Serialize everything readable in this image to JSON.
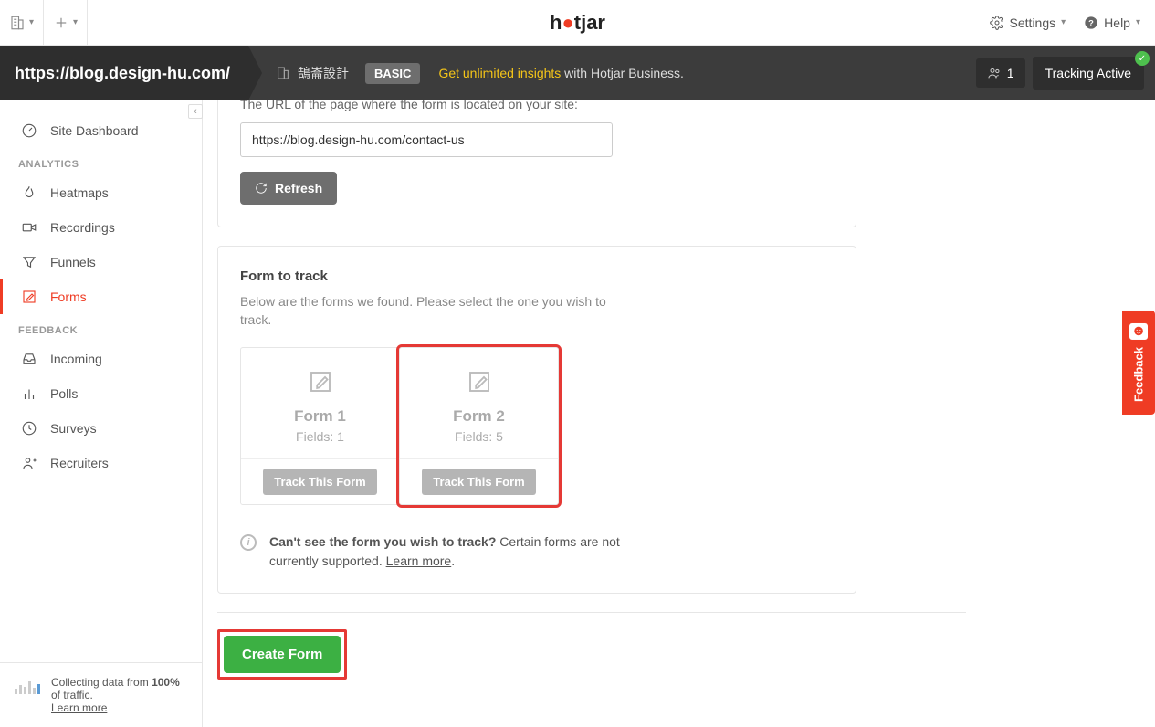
{
  "brand": {
    "name": "hotjar"
  },
  "top": {
    "settings": "Settings",
    "help": "Help"
  },
  "subheader": {
    "site_url": "https://blog.design-hu.com/",
    "site_name": "鵠崙設計",
    "plan_badge": "BASIC",
    "upsell_link": "Get unlimited insights",
    "upsell_rest": " with Hotjar Business.",
    "user_count": "1",
    "tracking": "Tracking Active"
  },
  "sidebar": {
    "dashboard": "Site Dashboard",
    "sections": {
      "analytics": "ANALYTICS",
      "feedback": "FEEDBACK"
    },
    "items": {
      "heatmaps": "Heatmaps",
      "recordings": "Recordings",
      "funnels": "Funnels",
      "forms": "Forms",
      "incoming": "Incoming",
      "polls": "Polls",
      "surveys": "Surveys",
      "recruiters": "Recruiters"
    },
    "footer": {
      "line1_a": "Collecting data from ",
      "line1_b": "100%",
      "line1_c": " of traffic.",
      "learn_more": "Learn more"
    }
  },
  "main": {
    "url_desc": "The URL of the page where the form is located on your site:",
    "url_value": "https://blog.design-hu.com/contact-us",
    "refresh": "Refresh",
    "form_section_title": "Form to track",
    "form_section_sub": "Below are the forms we found. Please select the one you wish to track.",
    "forms": [
      {
        "title": "Form 1",
        "fields": "Fields: 1",
        "track": "Track This Form",
        "highlighted": false
      },
      {
        "title": "Form 2",
        "fields": "Fields: 5",
        "track": "Track This Form",
        "highlighted": true
      }
    ],
    "info_bold": "Can't see the form you wish to track?",
    "info_rest": " Certain forms are not currently supported. ",
    "info_link": "Learn more",
    "create_form": "Create Form"
  },
  "feedback_tab": "Feedback"
}
